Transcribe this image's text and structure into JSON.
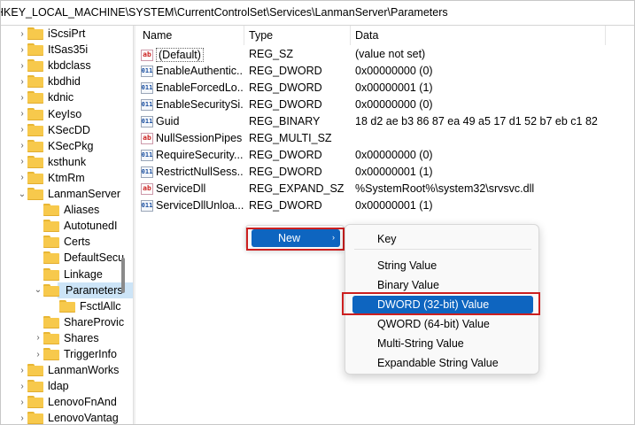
{
  "address": "HKEY_LOCAL_MACHINE\\SYSTEM\\CurrentControlSet\\Services\\LanmanServer\\Parameters",
  "tree": [
    {
      "label": "iScsiPrt",
      "expand": "›",
      "indent": 0
    },
    {
      "label": "ItSas35i",
      "expand": "›",
      "indent": 0
    },
    {
      "label": "kbdclass",
      "expand": "›",
      "indent": 0
    },
    {
      "label": "kbdhid",
      "expand": "›",
      "indent": 0
    },
    {
      "label": "kdnic",
      "expand": "›",
      "indent": 0
    },
    {
      "label": "KeyIso",
      "expand": "›",
      "indent": 0
    },
    {
      "label": "KSecDD",
      "expand": "›",
      "indent": 0
    },
    {
      "label": "KSecPkg",
      "expand": "›",
      "indent": 0
    },
    {
      "label": "ksthunk",
      "expand": "›",
      "indent": 0
    },
    {
      "label": "KtmRm",
      "expand": "›",
      "indent": 0
    },
    {
      "label": "LanmanServer",
      "expand": "⌄",
      "indent": 0
    },
    {
      "label": "Aliases",
      "expand": "",
      "indent": 1
    },
    {
      "label": "AutotunedI",
      "expand": "",
      "indent": 1
    },
    {
      "label": "Certs",
      "expand": "",
      "indent": 1
    },
    {
      "label": "DefaultSecu",
      "expand": "",
      "indent": 1
    },
    {
      "label": "Linkage",
      "expand": "",
      "indent": 1
    },
    {
      "label": "Parameters",
      "expand": "⌄",
      "indent": 1,
      "selected": true
    },
    {
      "label": "FsctlAllc",
      "expand": "",
      "indent": 2
    },
    {
      "label": "ShareProvic",
      "expand": "",
      "indent": 1
    },
    {
      "label": "Shares",
      "expand": "›",
      "indent": 1
    },
    {
      "label": "TriggerInfo",
      "expand": "›",
      "indent": 1
    },
    {
      "label": "LanmanWorks",
      "expand": "›",
      "indent": 0
    },
    {
      "label": "ldap",
      "expand": "›",
      "indent": 0
    },
    {
      "label": "LenovoFnAnd",
      "expand": "›",
      "indent": 0
    },
    {
      "label": "LenovoVantag",
      "expand": "›",
      "indent": 0
    }
  ],
  "columns": {
    "name": "Name",
    "type": "Type",
    "data": "Data"
  },
  "values": [
    {
      "icon": "ab",
      "name": "(Default)",
      "type": "REG_SZ",
      "data": "(value not set)"
    },
    {
      "icon": "bin",
      "name": "EnableAuthentic...",
      "type": "REG_DWORD",
      "data": "0x00000000 (0)"
    },
    {
      "icon": "bin",
      "name": "EnableForcedLo...",
      "type": "REG_DWORD",
      "data": "0x00000001 (1)"
    },
    {
      "icon": "bin",
      "name": "EnableSecuritySi...",
      "type": "REG_DWORD",
      "data": "0x00000000 (0)"
    },
    {
      "icon": "bin",
      "name": "Guid",
      "type": "REG_BINARY",
      "data": "18 d2 ae b3 86 87 ea 49 a5 17 d1 52 b7 eb c1 82"
    },
    {
      "icon": "ab",
      "name": "NullSessionPipes",
      "type": "REG_MULTI_SZ",
      "data": ""
    },
    {
      "icon": "bin",
      "name": "RequireSecurity...",
      "type": "REG_DWORD",
      "data": "0x00000000 (0)"
    },
    {
      "icon": "bin",
      "name": "RestrictNullSess...",
      "type": "REG_DWORD",
      "data": "0x00000001 (1)"
    },
    {
      "icon": "ab",
      "name": "ServiceDll",
      "type": "REG_EXPAND_SZ",
      "data": "%SystemRoot%\\system32\\srvsvc.dll"
    },
    {
      "icon": "bin",
      "name": "ServiceDllUnloa...",
      "type": "REG_DWORD",
      "data": "0x00000001 (1)"
    }
  ],
  "context_menu": {
    "new_label": "New",
    "arrow": "›"
  },
  "submenu": [
    {
      "label": "Key"
    },
    {
      "label": "String Value"
    },
    {
      "label": "Binary Value"
    },
    {
      "label": "DWORD (32-bit) Value",
      "active": true
    },
    {
      "label": "QWORD (64-bit) Value"
    },
    {
      "label": "Multi-String Value"
    },
    {
      "label": "Expandable String Value"
    }
  ],
  "icon_glyphs": {
    "ab": "ab",
    "bin": "011"
  },
  "colors": {
    "accent": "#0e65c0",
    "highlight_box": "#cc1f1f",
    "selection": "#cce4f7",
    "folder": "#f7c94c"
  }
}
